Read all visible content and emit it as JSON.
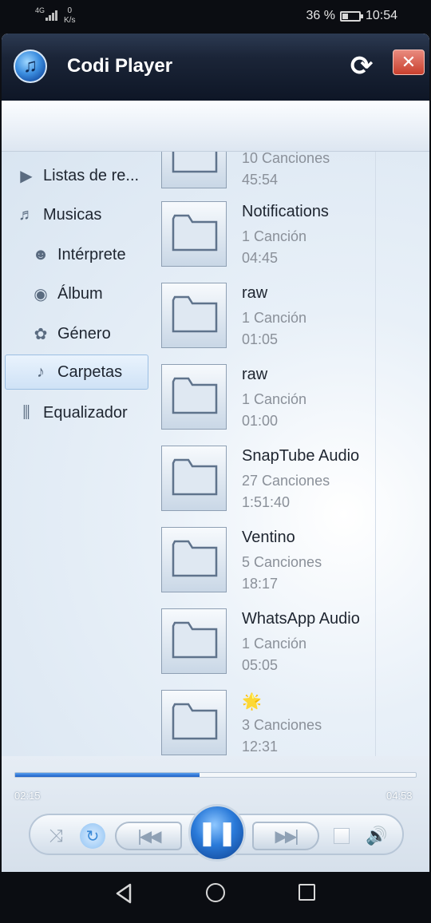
{
  "status_bar": {
    "network": "4G",
    "speed_value": "0",
    "speed_unit": "K/s",
    "battery_percent": "36 %",
    "battery_level": 0.36,
    "time": "10:54"
  },
  "app": {
    "title": "Codi Player",
    "icon": "music-note-icon"
  },
  "sidebar": {
    "items": [
      {
        "label": "Listas de re...",
        "icon": "playlist-icon"
      },
      {
        "label": "Musicas",
        "icon": "music-note-icon"
      },
      {
        "label": "Intérprete",
        "icon": "artist-icon"
      },
      {
        "label": "Álbum",
        "icon": "disc-icon"
      },
      {
        "label": "Género",
        "icon": "genre-icon"
      },
      {
        "label": "Carpetas",
        "icon": "folder-music-icon",
        "selected": true
      },
      {
        "label": "Equalizador",
        "icon": "equalizer-icon"
      }
    ]
  },
  "folders": [
    {
      "name": "",
      "count": "10 Canciones",
      "duration": "45:54"
    },
    {
      "name": "Notifications",
      "count": "1 Canción",
      "duration": "04:45"
    },
    {
      "name": "raw",
      "count": "1 Canción",
      "duration": "01:05"
    },
    {
      "name": "raw",
      "count": "1 Canción",
      "duration": "01:00"
    },
    {
      "name": "SnapTube Audio",
      "count": "27 Canciones",
      "duration": "1:51:40"
    },
    {
      "name": "Ventino",
      "count": "5 Canciones",
      "duration": "18:17"
    },
    {
      "name": "WhatsApp Audio",
      "count": "1 Canción",
      "duration": "05:05"
    },
    {
      "name": "🌟",
      "count": "3 Canciones",
      "duration": "12:31"
    }
  ],
  "player": {
    "elapsed": "02:15",
    "total": "04:53",
    "progress": 0.46,
    "state": "playing"
  }
}
